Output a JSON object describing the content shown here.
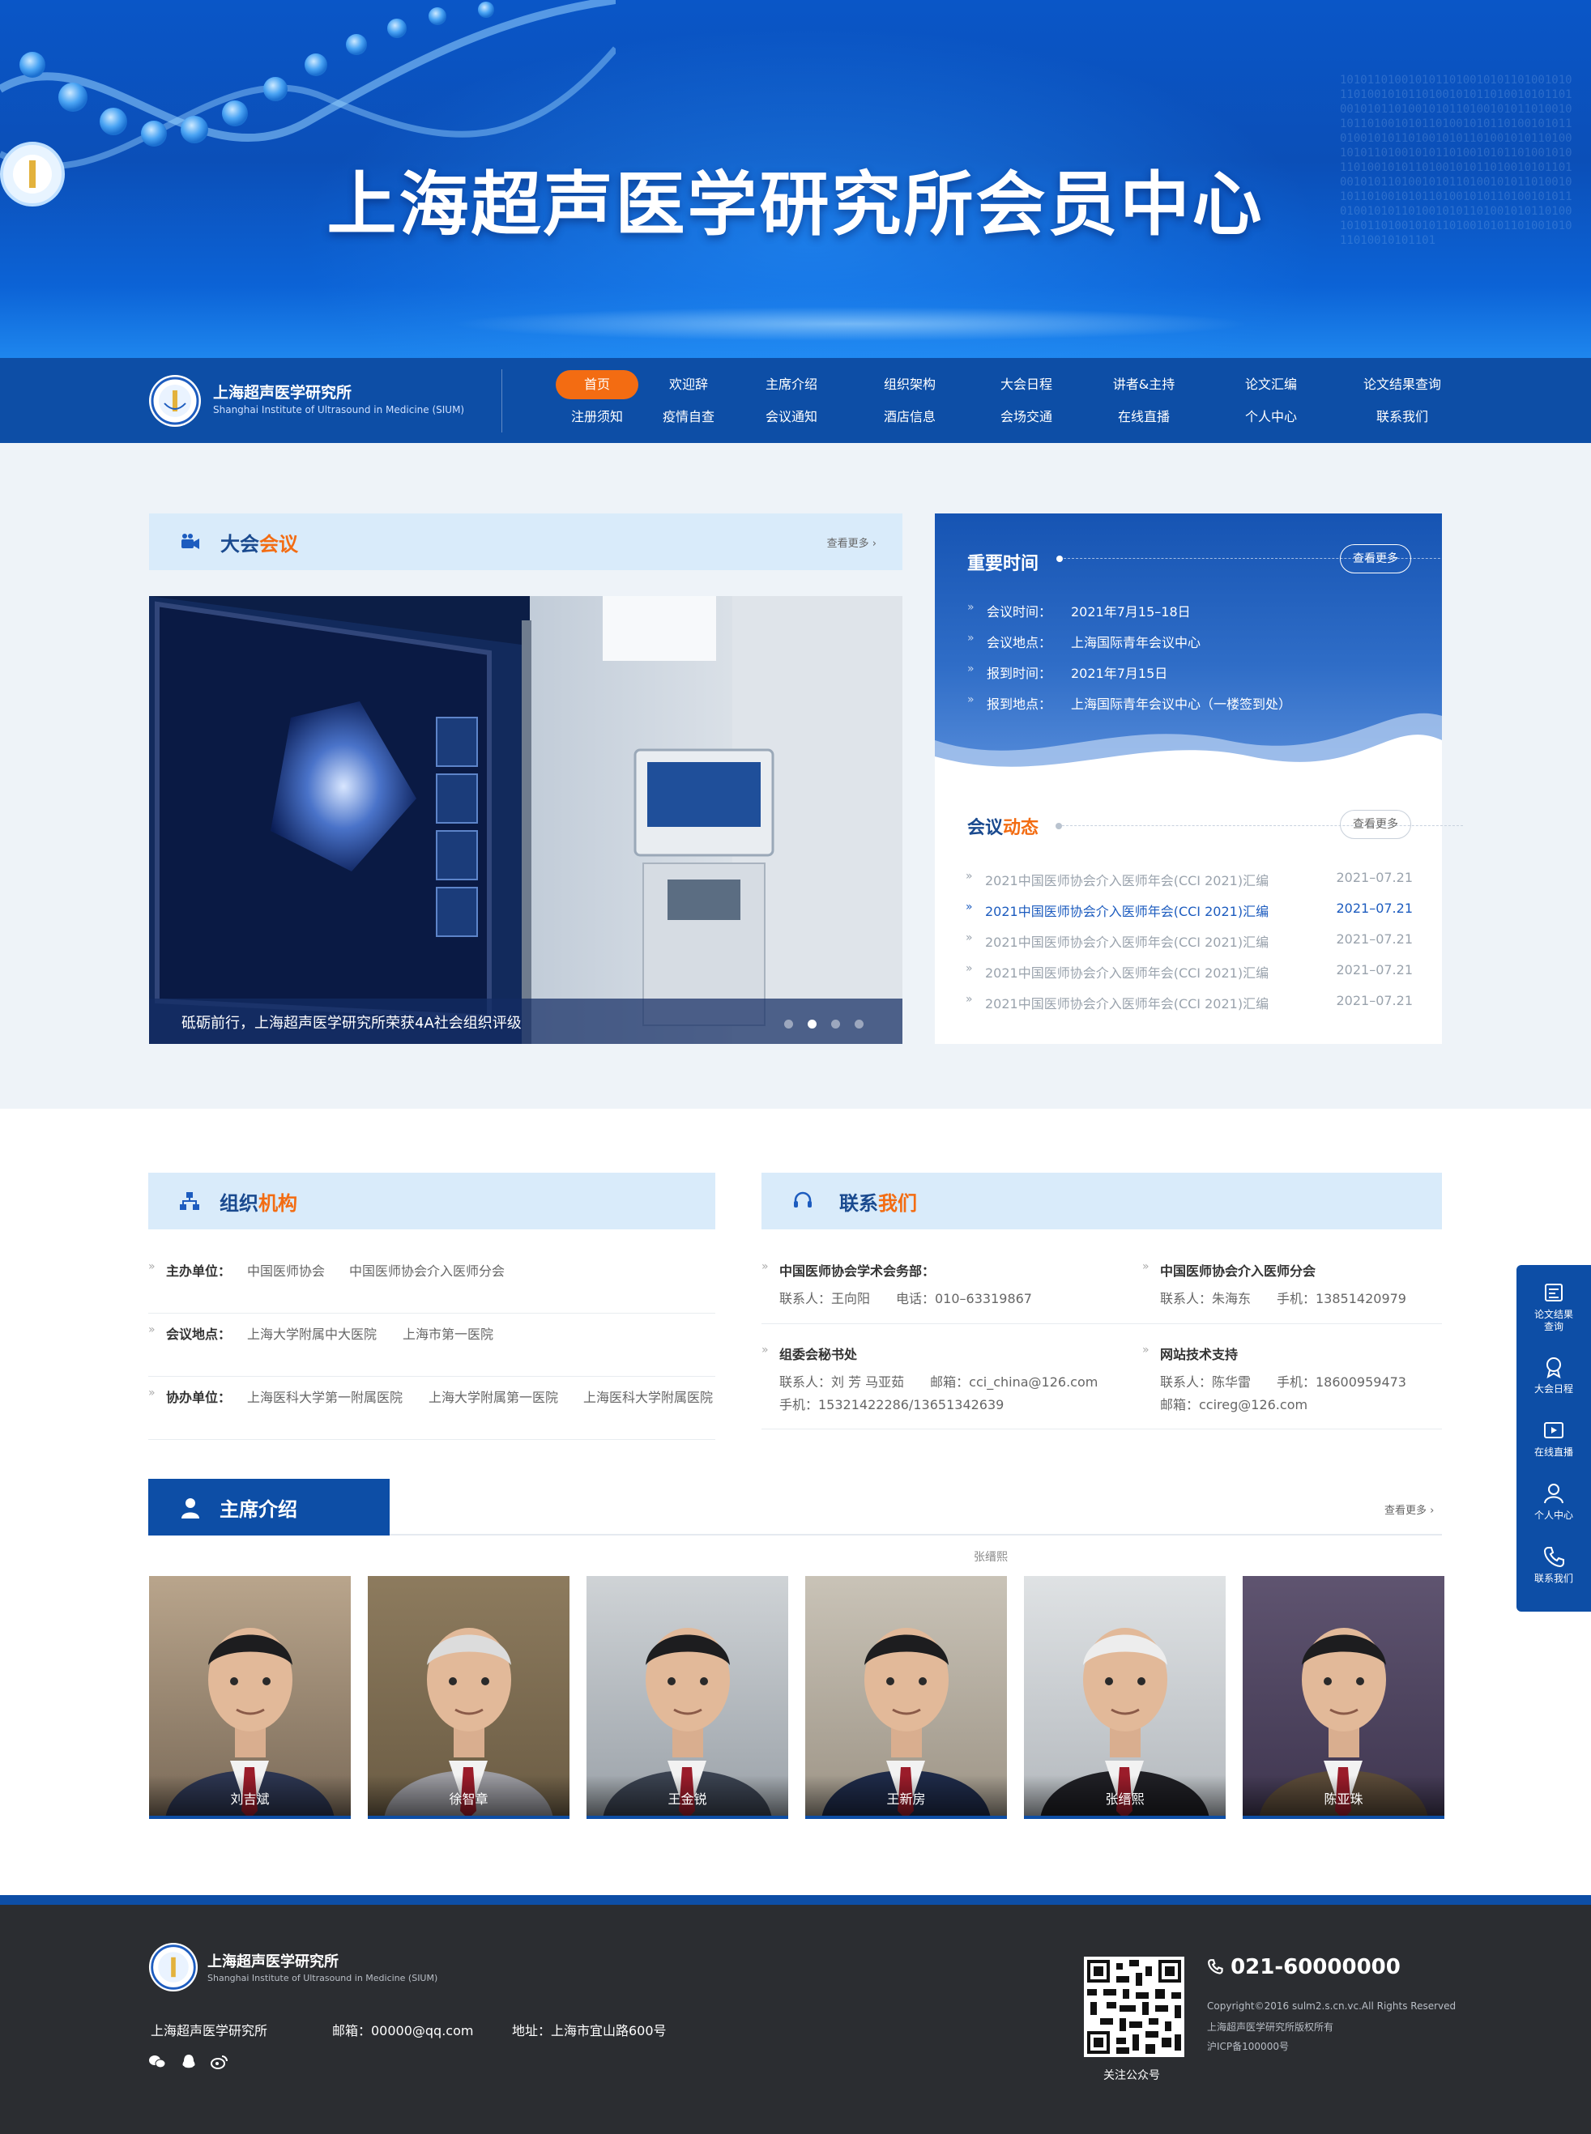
{
  "hero": {
    "title": "上海超声医学研究所会员中心"
  },
  "brand": {
    "name": "上海超声医学研究所",
    "name_en": "Shanghai Institute of Ultrasound in Medicine (SIUM)"
  },
  "nav": {
    "row1": [
      "首页",
      "欢迎辞",
      "主席介绍",
      "组织架构",
      "大会日程",
      "讲者&主持",
      "论文汇编",
      "论文结果查询"
    ],
    "row2": [
      "注册须知",
      "疫情自查",
      "会议通知",
      "酒店信息",
      "会场交通",
      "在线直播",
      "个人中心",
      "联系我们"
    ],
    "active": "首页"
  },
  "meeting": {
    "title_a": "大会",
    "title_b": "会议",
    "more": "查看更多 ›",
    "caption": "砥砺前行，上海超声医学研究所荣获4A社会组织评级"
  },
  "important_time": {
    "title": "重要时间",
    "more": "查看更多",
    "rows": [
      {
        "k": "会议时间：",
        "v": "2021年7月15–18日"
      },
      {
        "k": "会议地点：",
        "v": "上海国际青年会议中心"
      },
      {
        "k": "报到时间：",
        "v": "2021年7月15日"
      },
      {
        "k": "报到地点：",
        "v": "上海国际青年会议中心（一楼签到处）"
      }
    ]
  },
  "news": {
    "title_a": "会议",
    "title_b": "动态",
    "more": "查看更多",
    "items": [
      {
        "t": "2021中国医师协会介入医师年会(CCI 2021)汇编",
        "d": "2021–07.21"
      },
      {
        "t": "2021中国医师协会介入医师年会(CCI 2021)汇编",
        "d": "2021–07.21"
      },
      {
        "t": "2021中国医师协会介入医师年会(CCI 2021)汇编",
        "d": "2021–07.21"
      },
      {
        "t": "2021中国医师协会介入医师年会(CCI 2021)汇编",
        "d": "2021–07.21"
      },
      {
        "t": "2021中国医师协会介入医师年会(CCI 2021)汇编",
        "d": "2021–07.21"
      }
    ]
  },
  "org": {
    "title_a": "组织",
    "title_b": "机构",
    "rows": [
      {
        "k": "主办单位：",
        "v": [
          "中国医师协会",
          "中国医师协会介入医师分会"
        ]
      },
      {
        "k": "会议地点：",
        "v": [
          "上海大学附属中大医院",
          "上海市第一医院"
        ]
      },
      {
        "k": "协办单位：",
        "v": [
          "上海医科大学第一附属医院",
          "上海大学附属第一医院",
          "上海医科大学附属医院"
        ]
      }
    ]
  },
  "contact": {
    "title_a": "联系",
    "title_b": "我们",
    "cells": [
      {
        "h": "中国医师协会学术会务部：",
        "l1": "联系人：王向阳　　电话：010–63319867",
        "l2": ""
      },
      {
        "h": "中国医师协会介入医师分会",
        "l1": "联系人：朱海东　　手机：13851420979",
        "l2": ""
      },
      {
        "h": "组委会秘书处",
        "l1": "联系人：刘 芳  马亚茹　　邮箱：cci_china@126.com",
        "l2": "手机：15321422286/13651342639"
      },
      {
        "h": "网站技术支持",
        "l1": "联系人：陈华雷　　手机：18600959473",
        "l2": "邮箱：ccireg@126.com"
      }
    ]
  },
  "chairs": {
    "title": "主席介绍",
    "more": "查看更多 ›",
    "hover_name": "张缙熙",
    "people": [
      "刘吉斌",
      "徐智章",
      "王金锐",
      "王新房",
      "张缙熙",
      "陈亚珠"
    ]
  },
  "sidebar": {
    "items": [
      {
        "label1": "论文结果",
        "label2": "查询",
        "icon": "document-icon"
      },
      {
        "label1": "大会日程",
        "label2": "",
        "icon": "award-icon"
      },
      {
        "label1": "在线直播",
        "label2": "",
        "icon": "video-icon"
      },
      {
        "label1": "个人中心",
        "label2": "",
        "icon": "user-icon"
      },
      {
        "label1": "联系我们",
        "label2": "",
        "icon": "phone-icon"
      }
    ]
  },
  "footer": {
    "name": "上海超声医学研究所",
    "name_en": "Shanghai Institute of Ultrasound in Medicine (SIUM)",
    "org": "上海超声医学研究所",
    "email": "邮箱：00000@qq.com",
    "address": "地址：上海市宜山路600号",
    "qr_label": "关注公众号",
    "phone": "021-60000000",
    "copyright": "Copyright©2016 sulm2.s.cn.vc.All Rights Reserved",
    "rights": "上海超声医学研究所版权所有",
    "icp": "沪ICP备100000号"
  },
  "colors": {
    "primary": "#0d4ea6",
    "accent": "#f36c12",
    "section_head_bg": "#d9ebfa",
    "footer_bg": "#2b2d31"
  }
}
